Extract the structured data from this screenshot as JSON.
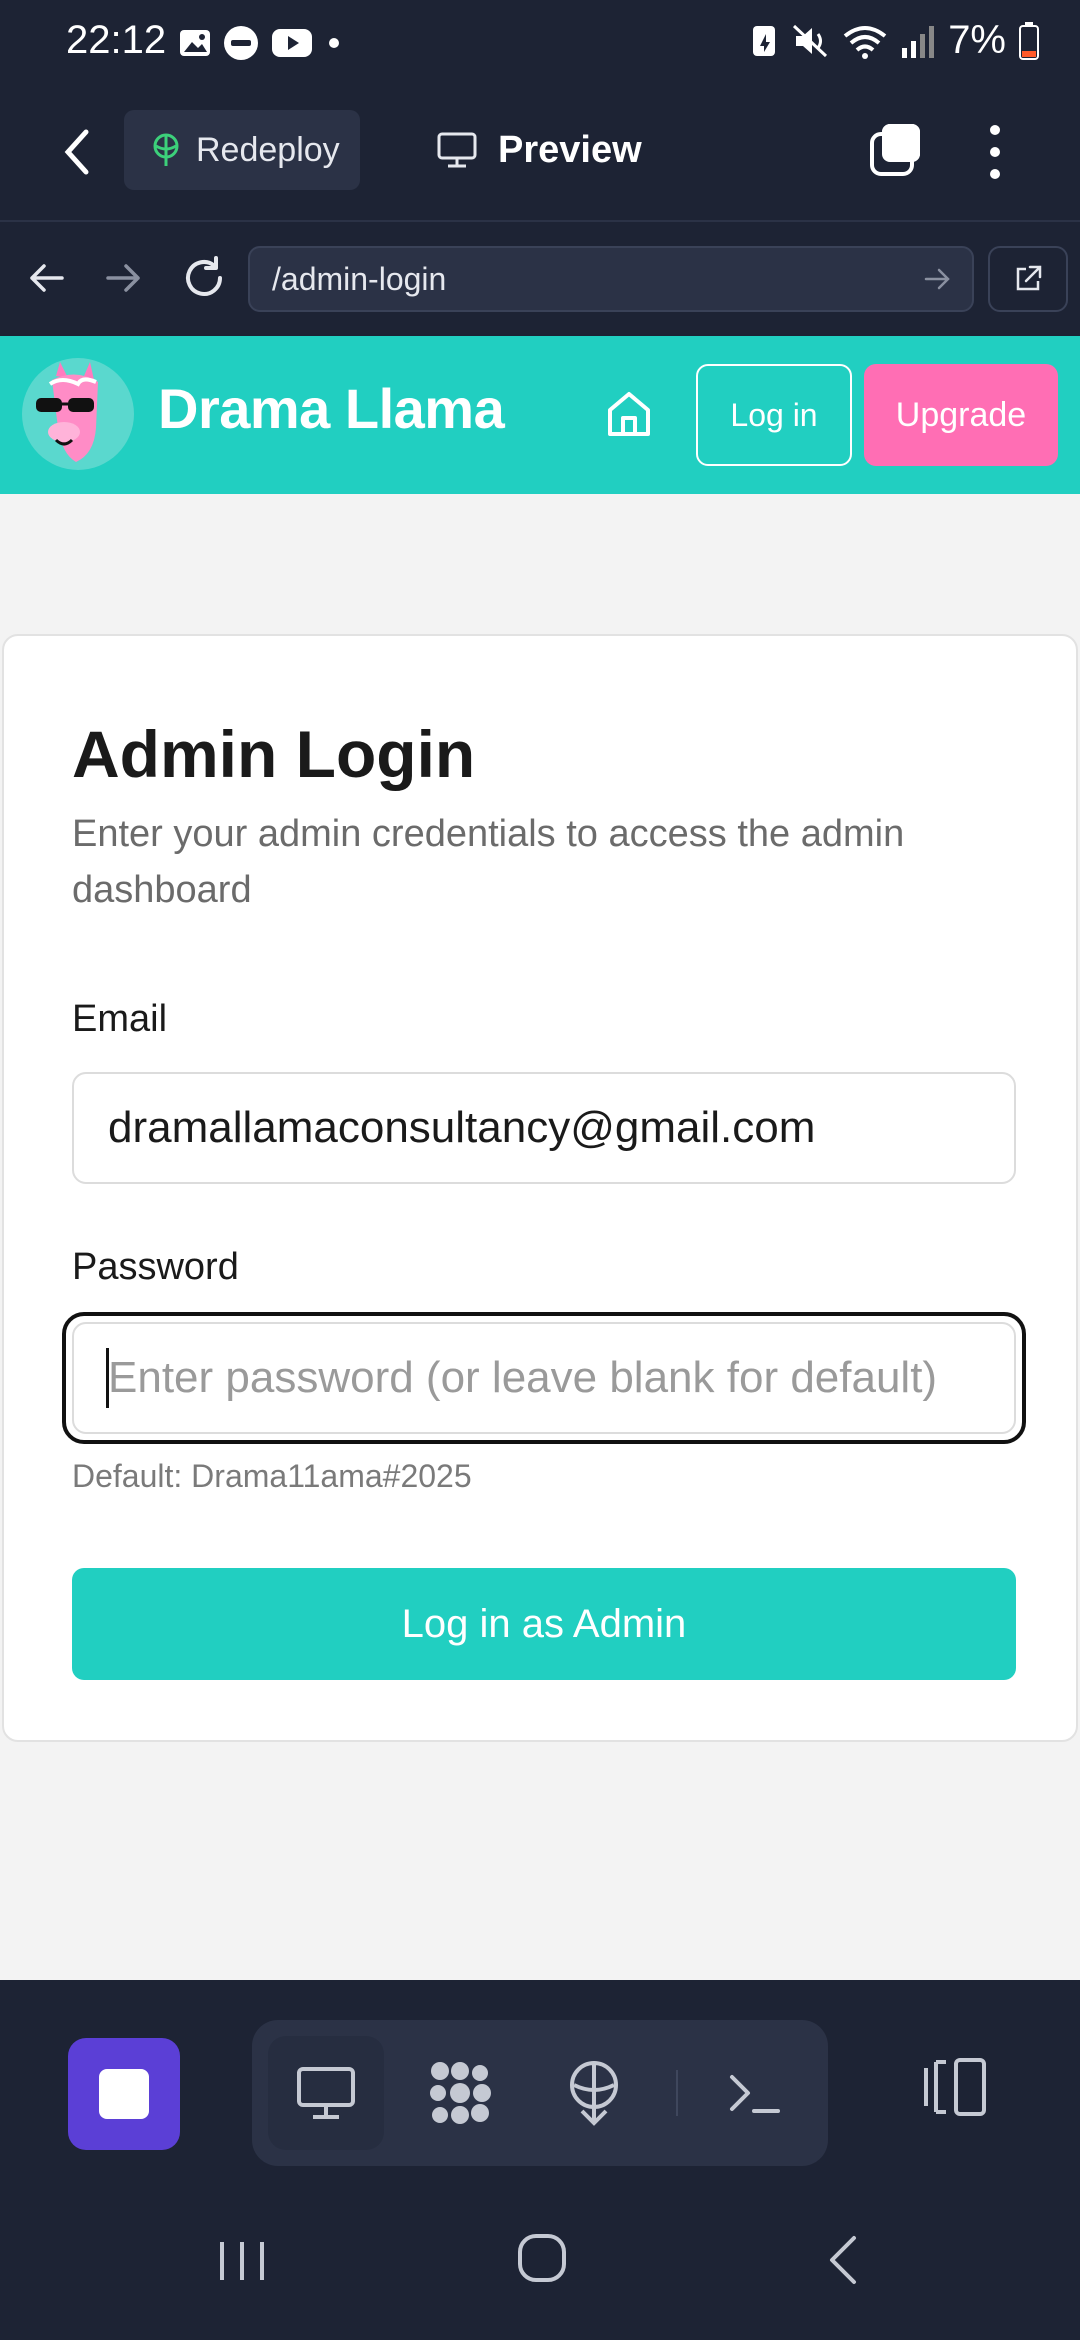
{
  "status_bar": {
    "time": "22:12",
    "battery": "7%"
  },
  "toolbar": {
    "redeploy_label": "Redeploy",
    "preview_label": "Preview"
  },
  "url_bar": {
    "url": "/admin-login"
  },
  "app_header": {
    "brand": "Drama Llama",
    "login_label": "Log in",
    "upgrade_label": "Upgrade"
  },
  "login_card": {
    "title": "Admin Login",
    "description": "Enter your admin credentials to access the admin dashboard",
    "email_label": "Email",
    "email_value": "dramallamaconsultancy@gmail.com",
    "password_label": "Password",
    "password_placeholder": "Enter password (or leave blank for default)",
    "password_hint": "Default: Drama11ama#2025",
    "submit_label": "Log in as Admin"
  },
  "colors": {
    "accent": "#21cfc1",
    "upgrade": "#ff6eb4",
    "dark_bg": "#1d2334",
    "stop_button": "#5b3fd6"
  },
  "workspace_tabs": [
    "monitor-icon",
    "apps-icon",
    "deploy-icon",
    "terminal-icon"
  ]
}
